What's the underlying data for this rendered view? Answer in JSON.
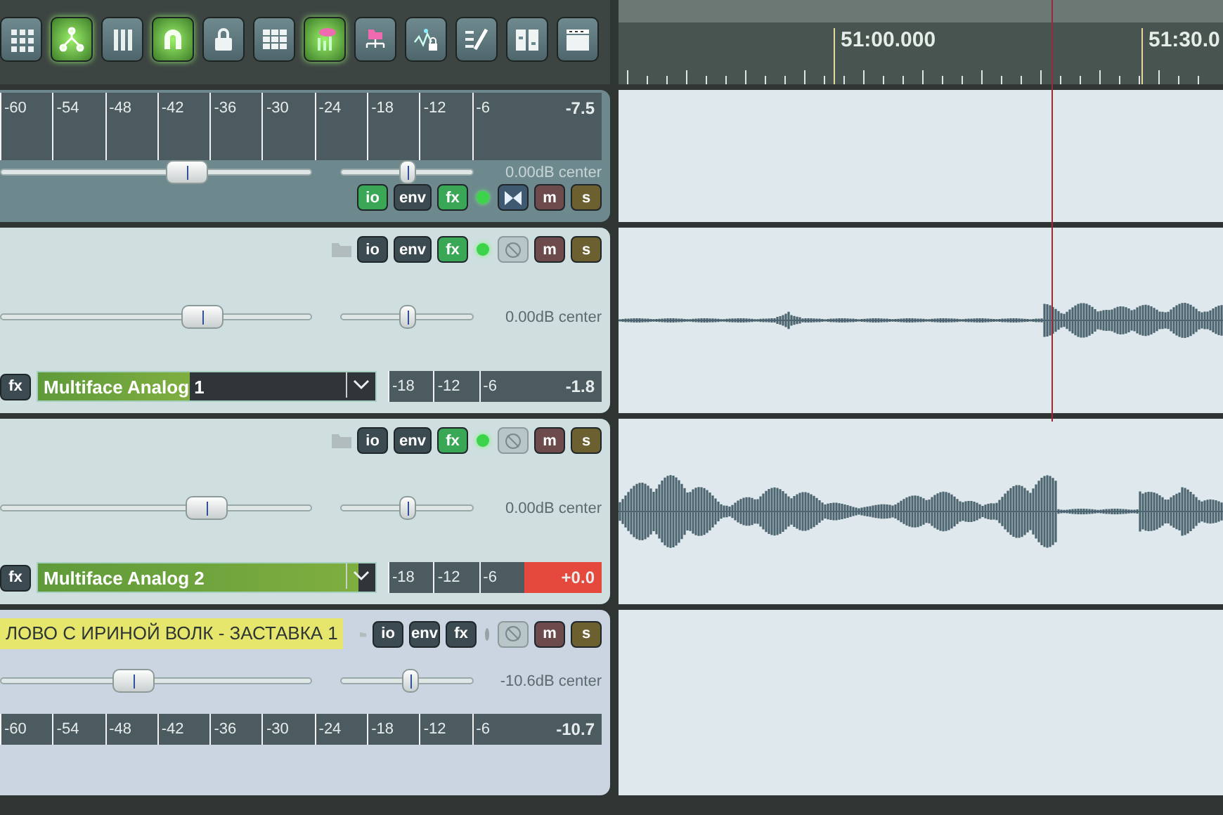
{
  "toolbar": [
    {
      "on": false
    },
    {
      "on": true
    },
    {
      "on": false
    },
    {
      "on": true
    },
    {
      "on": false
    },
    {
      "on": false
    },
    {
      "on": true
    },
    {
      "on": false
    },
    {
      "on": false
    },
    {
      "on": false
    },
    {
      "on": false
    },
    {
      "on": false
    }
  ],
  "ruler": {
    "labels": [
      "51:00.000",
      "51:30.0"
    ]
  },
  "tracks": [
    {
      "kind": "master",
      "meter": {
        "ticks": [
          "-60",
          "-54",
          "-48",
          "-42",
          "-36",
          "-30",
          "-24",
          "-18",
          "-12",
          "-6"
        ],
        "reading": "-7.5",
        "clipped": false
      },
      "volume": {
        "level": 0.6
      },
      "pan": {
        "level": 0.5
      },
      "readout": "0.00dB center",
      "buttons": [
        {
          "label": "io",
          "on": true
        },
        {
          "label": "env",
          "on": false
        },
        {
          "label": "fx",
          "on": true
        }
      ],
      "armed": true,
      "mute": "m",
      "solo": "s",
      "has_audio_item": false
    },
    {
      "kind": "track",
      "input": {
        "fx": "fx",
        "name": "Multiface Analog 1",
        "level": 0.45
      },
      "meter": {
        "ticks": [
          "-18",
          "-12",
          "-6"
        ],
        "reading": "-1.8",
        "clipped": false
      },
      "volume": {
        "level": 0.65
      },
      "pan": {
        "level": 0.5
      },
      "readout": "0.00dB center",
      "buttons": [
        {
          "label": "io",
          "on": false
        },
        {
          "label": "env",
          "on": false
        },
        {
          "label": "fx",
          "on": true
        }
      ],
      "armed": true,
      "mute": "m",
      "solo": "s",
      "has_audio_item": true
    },
    {
      "kind": "track",
      "input": {
        "fx": "fx",
        "name": "Multiface Analog 2",
        "level": 0.95
      },
      "meter": {
        "ticks": [
          "-18",
          "-12",
          "-6"
        ],
        "reading": "+0.0",
        "clipped": true
      },
      "volume": {
        "level": 0.66
      },
      "pan": {
        "level": 0.5
      },
      "readout": "0.00dB center",
      "buttons": [
        {
          "label": "io",
          "on": false
        },
        {
          "label": "env",
          "on": false
        },
        {
          "label": "fx",
          "on": true
        }
      ],
      "armed": true,
      "mute": "m",
      "solo": "s",
      "has_audio_item": true
    },
    {
      "kind": "track",
      "name": "ЛОВО С ИРИНОЙ ВОЛК - ЗАСТАВКА 1",
      "meter": {
        "ticks": [
          "-60",
          "-54",
          "-48",
          "-42",
          "-36",
          "-30",
          "-24",
          "-18",
          "-12",
          "-6"
        ],
        "reading": "-10.7",
        "clipped": false
      },
      "volume": {
        "level": 0.43
      },
      "pan": {
        "level": 0.53
      },
      "readout": "-10.6dB center",
      "buttons": [
        {
          "label": "io",
          "on": false
        },
        {
          "label": "env",
          "on": false
        },
        {
          "label": "fx",
          "on": false
        }
      ],
      "armed": false,
      "mute": "m",
      "solo": "s",
      "has_audio_item": false
    }
  ]
}
